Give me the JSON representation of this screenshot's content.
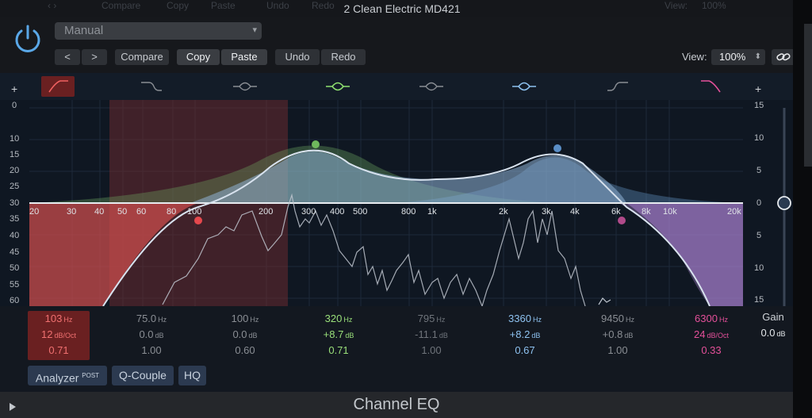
{
  "window": {
    "title": "2 Clean Electric MD421",
    "ghost_labels": [
      "Compare",
      "Copy",
      "Paste",
      "Undo",
      "Redo",
      "View:",
      "100%"
    ]
  },
  "header": {
    "preset": "Manual",
    "prev_label": "<",
    "next_label": ">",
    "compare_label": "Compare",
    "copy_label": "Copy",
    "paste_label": "Paste",
    "undo_label": "Undo",
    "redo_label": "Redo",
    "view_label": "View:",
    "view_value": "100%"
  },
  "graph": {
    "db_left": [
      "+",
      "0",
      "10",
      "15",
      "20",
      "25",
      "30",
      "35",
      "40",
      "45",
      "50",
      "55",
      "60"
    ],
    "db_right": [
      "+",
      "15",
      "10",
      "5",
      "0",
      "5",
      "10",
      "15"
    ],
    "hz_labels": [
      "20",
      "30",
      "40",
      "50",
      "60",
      "80",
      "100",
      "200",
      "300",
      "400",
      "500",
      "800",
      "1k",
      "2k",
      "3k",
      "4k",
      "6k",
      "8k",
      "10k",
      "20k"
    ]
  },
  "bands": [
    {
      "id": "lowcut",
      "icon": "low-cut-icon",
      "freq": "103",
      "gain": "12",
      "gain_unit": "dB/Oct",
      "q": "0.71",
      "color": "#e05a5a",
      "selected": true
    },
    {
      "id": "lowshelf",
      "icon": "low-shelf-icon",
      "freq": "75.0",
      "gain": "0.0",
      "gain_unit": "dB",
      "q": "1.00",
      "color": "#8a8e94",
      "selected": false
    },
    {
      "id": "para1",
      "icon": "bell-icon",
      "freq": "100",
      "gain": "0.0",
      "gain_unit": "dB",
      "q": "0.60",
      "color": "#8a8e94",
      "selected": false
    },
    {
      "id": "para2",
      "icon": "bell-icon",
      "freq": "320",
      "gain": "+8.7",
      "gain_unit": "dB",
      "q": "0.71",
      "color": "#9ae07a",
      "selected": false
    },
    {
      "id": "para3",
      "icon": "bell-icon",
      "freq": "795",
      "gain": "-11.1",
      "gain_unit": "dB",
      "q": "1.00",
      "color": "#6f747b",
      "selected": false
    },
    {
      "id": "para4",
      "icon": "bell-icon",
      "freq": "3360",
      "gain": "+8.2",
      "gain_unit": "dB",
      "q": "0.67",
      "color": "#8ec2f0",
      "selected": false
    },
    {
      "id": "highshelf",
      "icon": "high-shelf-icon",
      "freq": "9450",
      "gain": "+0.8",
      "gain_unit": "dB",
      "q": "1.00",
      "color": "#8a8e94",
      "selected": false
    },
    {
      "id": "highcut",
      "icon": "high-cut-icon",
      "freq": "6300",
      "gain": "24",
      "gain_unit": "dB/Oct",
      "q": "0.33",
      "color": "#e4509a",
      "selected": false
    }
  ],
  "units": {
    "hz": "Hz"
  },
  "gain": {
    "label": "Gain",
    "value": "0.0",
    "unit": "dB"
  },
  "footer": {
    "analyzer_label": "Analyzer",
    "analyzer_sup": "POST",
    "qcouple_label": "Q-Couple",
    "hq_label": "HQ",
    "plugin_name": "Channel EQ"
  }
}
